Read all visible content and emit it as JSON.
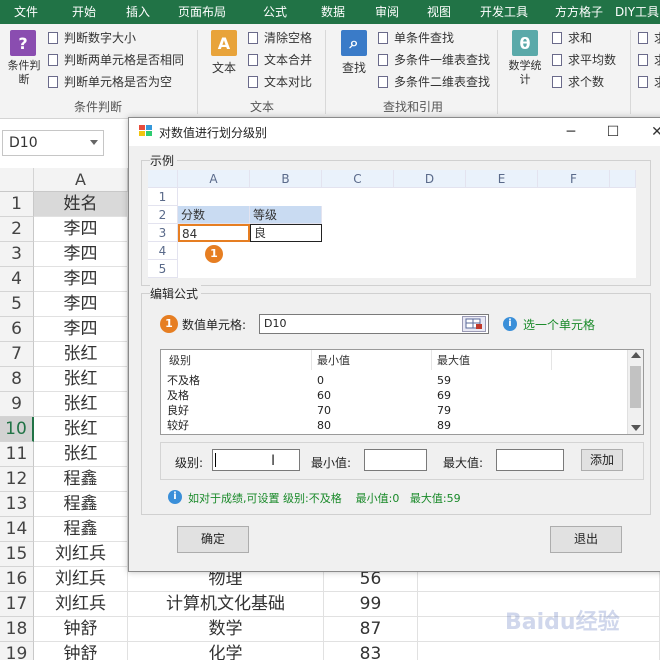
{
  "ribbon": {
    "tabs": [
      "文件",
      "开始",
      "插入",
      "页面布局",
      "公式",
      "数据",
      "审阅",
      "视图",
      "开发工具",
      "方方格子",
      "DIY工具"
    ],
    "groups": {
      "condition": {
        "big_label": "条件判断",
        "items": [
          "判断数字大小",
          "判断两单元格是否相同",
          "判断单元格是否为空"
        ],
        "group_label": "条件判断"
      },
      "text": {
        "big_label": "文本",
        "items": [
          "清除空格",
          "文本合并",
          "文本对比"
        ],
        "group_label": "文本"
      },
      "lookup": {
        "big_label": "查找",
        "items": [
          "单条件查找",
          "多条件一维表查找",
          "多条件二维表查找"
        ],
        "group_label": "查找和引用"
      },
      "stats": {
        "big_label": "数学统计",
        "items": [
          "求和",
          "求平均数",
          "求个数"
        ]
      },
      "extra": {
        "items": [
          "求",
          "求",
          "求"
        ]
      }
    }
  },
  "namebox": "D10",
  "sheet": {
    "col_A": "A",
    "rows": [
      {
        "n": "1",
        "a": "姓名",
        "b": "",
        "c": ""
      },
      {
        "n": "2",
        "a": "李四",
        "b": "",
        "c": ""
      },
      {
        "n": "3",
        "a": "李四",
        "b": "",
        "c": ""
      },
      {
        "n": "4",
        "a": "李四",
        "b": "",
        "c": ""
      },
      {
        "n": "5",
        "a": "李四",
        "b": "",
        "c": ""
      },
      {
        "n": "6",
        "a": "李四",
        "b": "",
        "c": ""
      },
      {
        "n": "7",
        "a": "张红",
        "b": "",
        "c": ""
      },
      {
        "n": "8",
        "a": "张红",
        "b": "",
        "c": ""
      },
      {
        "n": "9",
        "a": "张红",
        "b": "",
        "c": ""
      },
      {
        "n": "10",
        "a": "张红",
        "b": "",
        "c": ""
      },
      {
        "n": "11",
        "a": "张红",
        "b": "",
        "c": ""
      },
      {
        "n": "12",
        "a": "程鑫",
        "b": "",
        "c": ""
      },
      {
        "n": "13",
        "a": "程鑫",
        "b": "",
        "c": ""
      },
      {
        "n": "14",
        "a": "程鑫",
        "b": "",
        "c": ""
      },
      {
        "n": "15",
        "a": "刘红兵",
        "b": "",
        "c": ""
      },
      {
        "n": "16",
        "a": "刘红兵",
        "b": "物理",
        "c": "56"
      },
      {
        "n": "17",
        "a": "刘红兵",
        "b": "计算机文化基础",
        "c": "99"
      },
      {
        "n": "18",
        "a": "钟舒",
        "b": "数学",
        "c": "87"
      },
      {
        "n": "19",
        "a": "钟舒",
        "b": "化学",
        "c": "83"
      }
    ]
  },
  "dialog": {
    "title": "对数值进行划分级别",
    "example_label": "示例",
    "mini_grid": {
      "cols": [
        "A",
        "B",
        "C",
        "D",
        "E",
        "F"
      ],
      "rows": [
        "1",
        "2",
        "3",
        "4",
        "5"
      ],
      "r2": [
        "分数",
        "等级"
      ],
      "r3": [
        "84",
        "良"
      ]
    },
    "badge1": "1",
    "formula_label": "编辑公式",
    "value_cell_label": "数值单元格:",
    "value_cell_value": "D10",
    "hint_select": "选一个单元格",
    "list_headers": [
      "级别",
      "最小值",
      "最大值"
    ],
    "list_rows": [
      [
        "不及格",
        "0",
        "59"
      ],
      [
        "及格",
        "60",
        "69"
      ],
      [
        "良好",
        "70",
        "79"
      ],
      [
        "较好",
        "80",
        "89"
      ]
    ],
    "level_label": "级别:",
    "level_value": "",
    "min_label": "最小值:",
    "max_label": "最大值:",
    "add_button": "添加",
    "tip": "如对于成绩,可设置 级别:不及格    最小值:0   最大值:59",
    "ok_button": "确定",
    "exit_button": "退出"
  },
  "watermark": "Baidu经验"
}
